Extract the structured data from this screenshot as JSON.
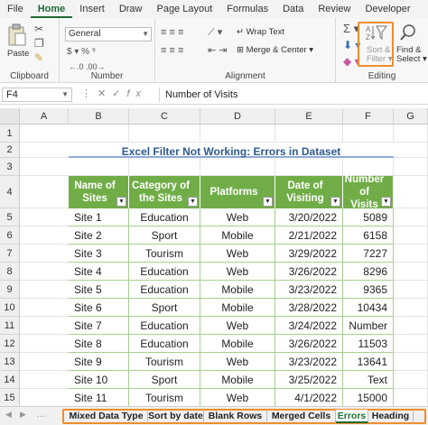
{
  "ribbon_tabs": [
    "File",
    "Home",
    "Insert",
    "Draw",
    "Page Layout",
    "Formulas",
    "Data",
    "Review",
    "Developer"
  ],
  "ribbon": {
    "clipboard": {
      "label": "Clipboard",
      "paste": "Paste"
    },
    "number": {
      "label": "Number",
      "format": "General"
    },
    "alignment": {
      "label": "Alignment",
      "wrap_text": "Wrap Text",
      "merge_center": "Merge & Center"
    },
    "editing": {
      "label": "Editing",
      "sort_filter": "Sort &",
      "sort_filter2": "Filter",
      "find_select": "Find &",
      "find_select2": "Select"
    }
  },
  "formula_bar": {
    "name_box": "F4",
    "fx": "fx",
    "content": "Number of Visits"
  },
  "columns": [
    "A",
    "B",
    "C",
    "D",
    "E",
    "F",
    "G"
  ],
  "rows": [
    "1",
    "2",
    "3",
    "4",
    "5",
    "6",
    "7",
    "8",
    "9",
    "10",
    "11",
    "12",
    "13",
    "14",
    "15"
  ],
  "sheet_title": "Excel Filter Not Working: Errors in Dataset",
  "table": {
    "headers": [
      "Name of Sites",
      "Category of the Sites",
      "Platforms",
      "Date of Visiting",
      "Number of Visits"
    ],
    "rows": [
      [
        "Site 1",
        "Education",
        "Web",
        "3/20/2022",
        "5089"
      ],
      [
        "Site 2",
        "Sport",
        "Mobile",
        "2/21/2022",
        "6158"
      ],
      [
        "Site 3",
        "Tourism",
        "Web",
        "3/29/2022",
        "7227"
      ],
      [
        "Site 4",
        "Education",
        "Web",
        "3/26/2022",
        "8296"
      ],
      [
        "Site 5",
        "Education",
        "Mobile",
        "3/23/2022",
        "9365"
      ],
      [
        "Site 6",
        "Sport",
        "Mobile",
        "3/28/2022",
        "10434"
      ],
      [
        "Site 7",
        "Education",
        "Web",
        "3/24/2022",
        "Number"
      ],
      [
        "Site 8",
        "Education",
        "Mobile",
        "3/26/2022",
        "11503"
      ],
      [
        "Site 9",
        "Tourism",
        "Web",
        "3/23/2022",
        "13641"
      ],
      [
        "Site 10",
        "Sport",
        "Mobile",
        "3/25/2022",
        "Text"
      ],
      [
        "Site 11",
        "Tourism",
        "Web",
        "4/1/2022",
        "15000"
      ]
    ]
  },
  "sheet_tabs": [
    "Mixed Data Type",
    "Sort by date",
    "Blank Rows",
    "Merged Cells",
    "Errors",
    "Heading"
  ],
  "active_sheet": "Errors",
  "accent": "#70ad47",
  "highlight": "#f08c2a"
}
